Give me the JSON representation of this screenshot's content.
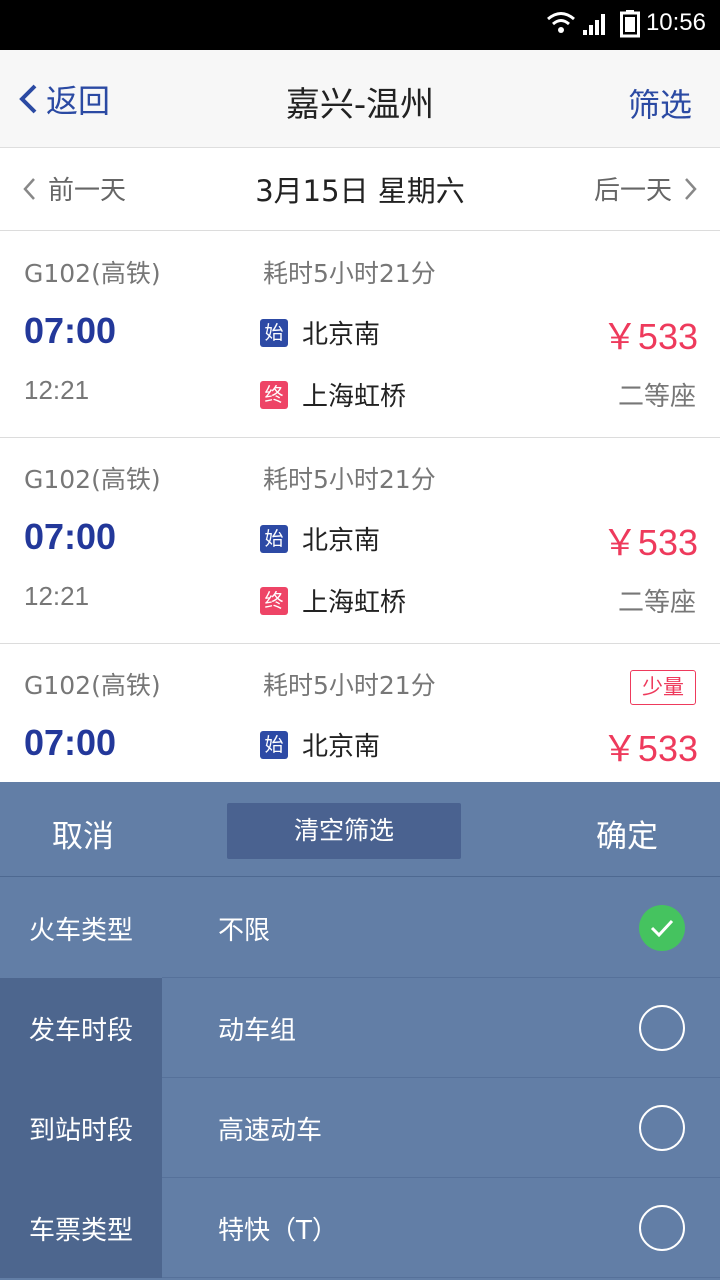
{
  "status": {
    "time": "10:56"
  },
  "nav": {
    "back_label": "返回",
    "title": "嘉兴-温州",
    "filter_label": "筛选"
  },
  "date": {
    "prev_label": "前一天",
    "current": "3月15日 星期六",
    "next_label": "后一天"
  },
  "trains": [
    {
      "train": "G102(高铁)",
      "duration": "耗时5小时21分",
      "depart": "07:00",
      "arrive": "12:21",
      "from_tag": "始",
      "from": "北京南",
      "to_tag": "终",
      "to": "上海虹桥",
      "price": "￥533",
      "seat": "二等座",
      "badge": ""
    },
    {
      "train": "G102(高铁)",
      "duration": "耗时5小时21分",
      "depart": "07:00",
      "arrive": "12:21",
      "from_tag": "始",
      "from": "北京南",
      "to_tag": "终",
      "to": "上海虹桥",
      "price": "￥533",
      "seat": "二等座",
      "badge": ""
    },
    {
      "train": "G102(高铁)",
      "duration": "耗时5小时21分",
      "depart": "07:00",
      "from_tag": "始",
      "from": "北京南",
      "price": "￥533",
      "badge": "少量"
    }
  ],
  "filter": {
    "cancel_label": "取消",
    "clear_label": "清空筛选",
    "confirm_label": "确定",
    "categories": [
      {
        "label": "火车类型",
        "active": true
      },
      {
        "label": "发车时段",
        "active": false
      },
      {
        "label": "到站时段",
        "active": false
      },
      {
        "label": "车票类型",
        "active": false
      }
    ],
    "options": [
      {
        "label": "不限",
        "checked": true
      },
      {
        "label": "动车组",
        "checked": false
      },
      {
        "label": "高速动车",
        "checked": false
      },
      {
        "label": "特快（T）",
        "checked": false
      }
    ]
  },
  "colors": {
    "accent": "#2b4aa3",
    "price": "#ee3a5c",
    "panel": "#627ea6",
    "check": "#45c35f"
  }
}
